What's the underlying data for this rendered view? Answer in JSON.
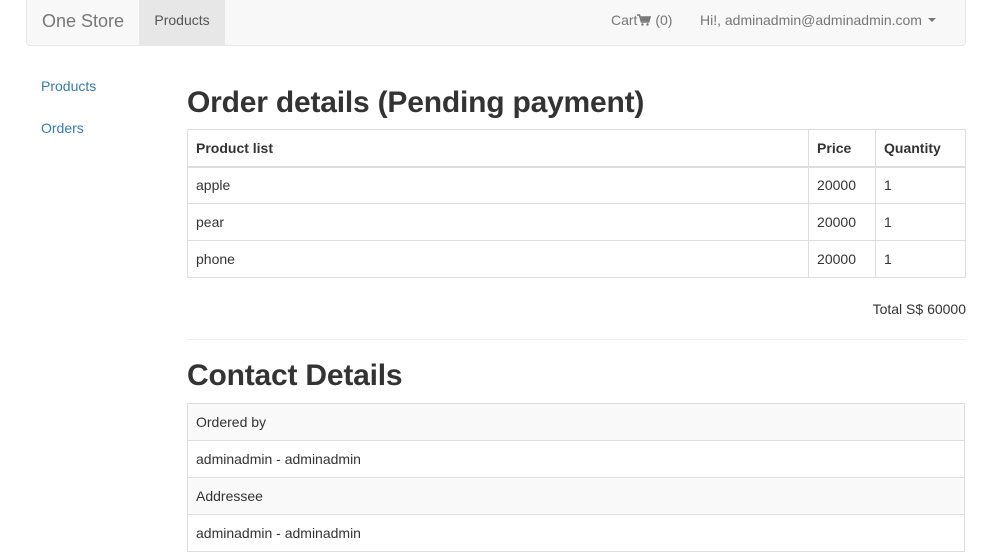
{
  "navbar": {
    "brand": "One Store",
    "products_tab": "Products",
    "cart_label": "Cart",
    "cart_count": "(0)",
    "user_greeting": "Hi!, adminadmin@adminadmin.com"
  },
  "sidebar": {
    "items": [
      {
        "label": "Products"
      },
      {
        "label": "Orders"
      }
    ]
  },
  "order": {
    "title": "Order details (Pending payment)",
    "columns": [
      "Product list",
      "Price",
      "Quantity"
    ],
    "rows": [
      {
        "name": "apple",
        "price": "20000",
        "quantity": "1"
      },
      {
        "name": "pear",
        "price": "20000",
        "quantity": "1"
      },
      {
        "name": "phone",
        "price": "20000",
        "quantity": "1"
      }
    ],
    "total": "Total S$ 60000"
  },
  "contact": {
    "title": "Contact Details",
    "ordered_by_label": "Ordered by",
    "ordered_by_value": "adminadmin - adminadmin",
    "addressee_label": "Addressee",
    "addressee_value": "adminadmin - adminadmin"
  },
  "colors": {
    "link": "#337ab7",
    "navbar_bg": "#f8f8f8",
    "active_tab_bg": "#e7e7e7",
    "text": "#333333"
  }
}
